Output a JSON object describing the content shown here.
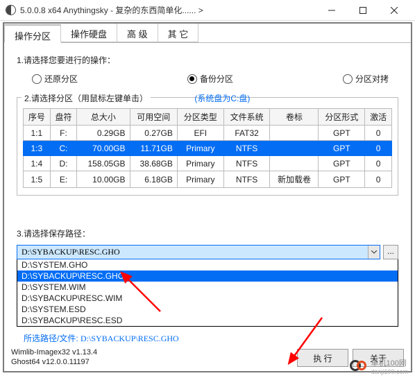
{
  "window": {
    "title": "5.0.0.8 x64 Anythingsky - 复杂的东西简单化...... >"
  },
  "tabs": [
    "操作分区",
    "操作硬盘",
    "高 级",
    "其 它"
  ],
  "section1": {
    "label": "1.请选择您要进行的操作：",
    "options": {
      "restore": "还原分区",
      "backup": "备份分区",
      "copy": "分区对拷"
    },
    "selected": "backup"
  },
  "section2": {
    "label": "2.请选择分区（用鼠标左键单击）",
    "sysdisk": "(系统盘为C:盘)",
    "cols": [
      "序号",
      "盘符",
      "总大小",
      "可用空间",
      "分区类型",
      "文件系统",
      "卷标",
      "分区形式",
      "激活"
    ],
    "rows": [
      {
        "idx": "1:1",
        "drv": "F:",
        "total": "0.29GB",
        "free": "0.27GB",
        "ptype": "EFI",
        "fs": "FAT32",
        "vol": "",
        "scheme": "GPT",
        "act": "0",
        "sel": false
      },
      {
        "idx": "1:3",
        "drv": "C:",
        "total": "70.00GB",
        "free": "11.71GB",
        "ptype": "Primary",
        "fs": "NTFS",
        "vol": "",
        "scheme": "GPT",
        "act": "0",
        "sel": true
      },
      {
        "idx": "1:4",
        "drv": "D:",
        "total": "158.05GB",
        "free": "38.68GB",
        "ptype": "Primary",
        "fs": "NTFS",
        "vol": "",
        "scheme": "GPT",
        "act": "0",
        "sel": false
      },
      {
        "idx": "1:5",
        "drv": "E:",
        "total": "10.00GB",
        "free": "6.18GB",
        "ptype": "Primary",
        "fs": "NTFS",
        "vol": "新加载卷",
        "scheme": "GPT",
        "act": "0",
        "sel": false
      }
    ]
  },
  "section3": {
    "label": "3.请选择保存路径：",
    "combo_value": "D:\\SYBACKUP\\RESC.GHO",
    "browse": "...",
    "dropdown": [
      {
        "text": "D:\\SYSTEM.GHO",
        "hl": false
      },
      {
        "text": "D:\\SYBACKUP\\RESC.GHO",
        "hl": true
      },
      {
        "text": "D:\\SYSTEM.WIM",
        "hl": false
      },
      {
        "text": "D:\\SYBACKUP\\RESC.WIM",
        "hl": false
      },
      {
        "text": "D:\\SYSTEM.ESD",
        "hl": false
      },
      {
        "text": "D:\\SYBACKUP\\RESC.ESD",
        "hl": false
      }
    ],
    "selected_label": "所选路径/文件:",
    "selected_value": "D:\\SYBACKUP\\RESC.GHO"
  },
  "footer": {
    "lib1": "Wimlib-Imagex32 v1.13.4",
    "lib2": "Ghost64 v12.0.0.11197",
    "exec": "执 行",
    "about": "关于"
  },
  "watermark": {
    "name": "单机100网",
    "url": "danji100.com"
  }
}
